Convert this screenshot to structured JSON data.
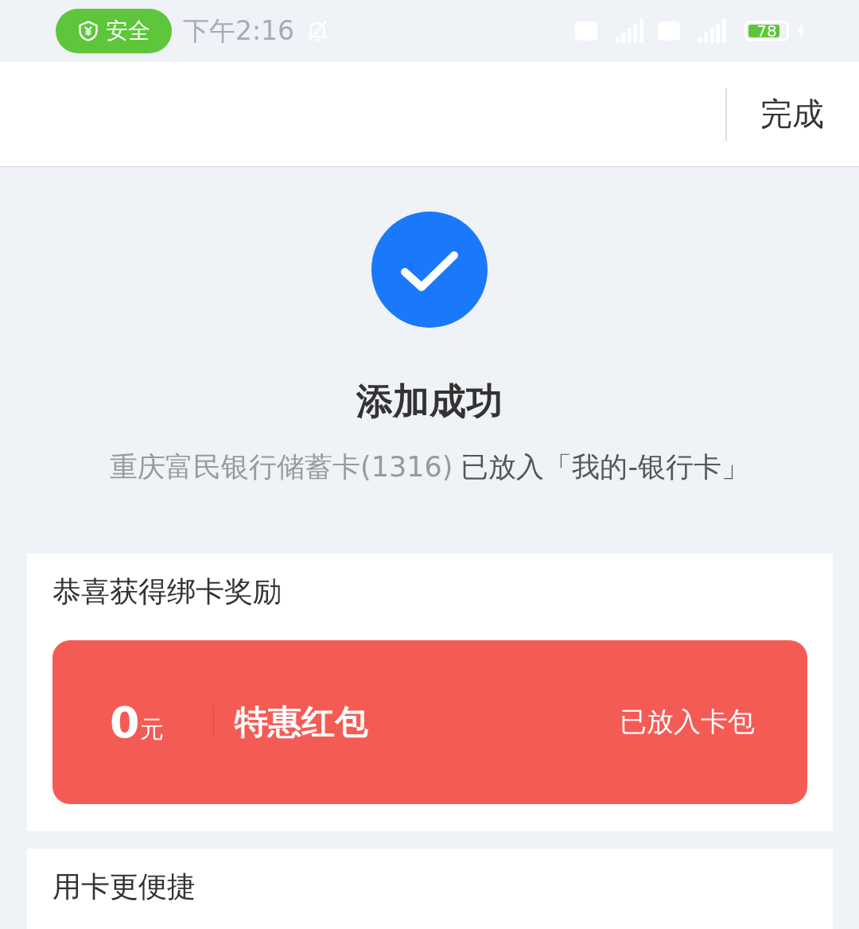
{
  "status_bar": {
    "security_badge": "安全",
    "time": "下午2:16",
    "battery": "78"
  },
  "header": {
    "done_button": "完成"
  },
  "result": {
    "title": "添加成功",
    "card_name": "重庆富民银行储蓄卡(1316)",
    "placed_text": "已放入「我的-银行卡」"
  },
  "reward_section": {
    "heading": "恭喜获得绑卡奖励",
    "coupons": [
      {
        "amount": "0",
        "unit": "元",
        "name": "特惠红包",
        "status": "已放入卡包",
        "color": "#f55b55"
      }
    ]
  },
  "usage_section": {
    "heading": "用卡更便捷"
  }
}
